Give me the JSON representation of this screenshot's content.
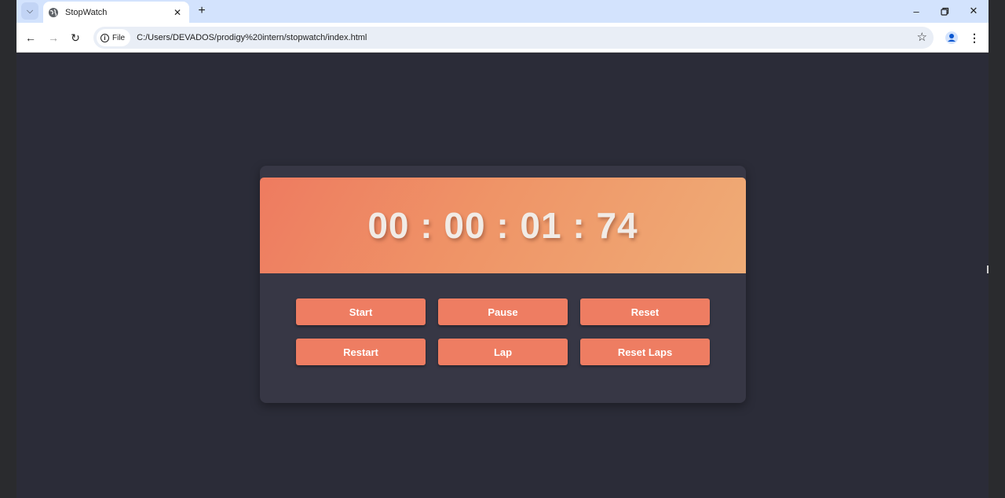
{
  "browser": {
    "tab": {
      "title": "StopWatch"
    },
    "address": {
      "chip_label": "File",
      "url": "C:/Users/DEVADOS/prodigy%20intern/stopwatch/index.html"
    }
  },
  "stopwatch": {
    "time": "00 : 00 : 01 : 74",
    "buttons": {
      "start": "Start",
      "pause": "Pause",
      "reset": "Reset",
      "restart": "Restart",
      "lap": "Lap",
      "reset_laps": "Reset Laps"
    }
  },
  "colors": {
    "accent": "#ee7d62",
    "display_gradient_start": "#ee7b60",
    "display_gradient_end": "#efac76",
    "page_background": "#2b2c38",
    "card_background": "#373745"
  }
}
